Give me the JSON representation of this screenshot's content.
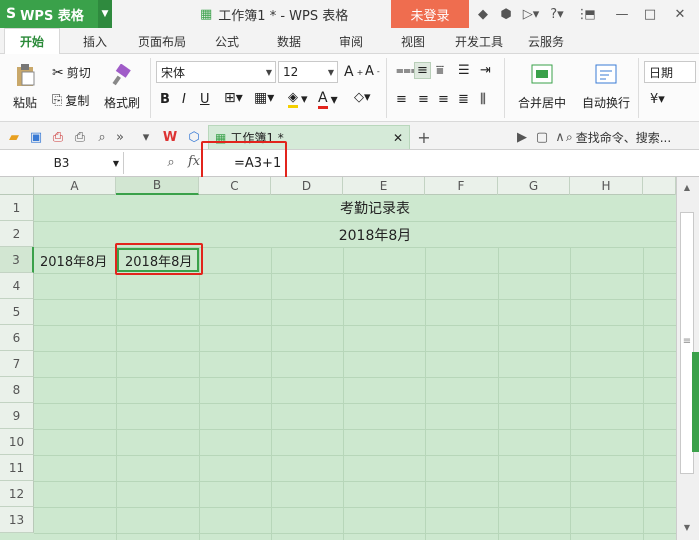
{
  "app": {
    "logo_text": "WPS 表格",
    "window_title": "工作簿1 * - WPS 表格",
    "login_label": "未登录"
  },
  "menu": {
    "tabs": [
      "开始",
      "插入",
      "页面布局",
      "公式",
      "数据",
      "审阅",
      "视图",
      "开发工具",
      "云服务"
    ]
  },
  "ribbon": {
    "paste_label": "粘贴",
    "cut_label": "剪切",
    "copy_label": "复制",
    "format_painter_label": "格式刷",
    "font_name": "宋体",
    "font_size": "12",
    "merge_label": "合并居中",
    "wrap_label": "自动换行",
    "number_format": "日期"
  },
  "qa": {
    "doc_tab": "工作簿1 *",
    "search_placeholder": "查找命令、搜索..."
  },
  "formula_bar": {
    "name_box": "B3",
    "fx": "fx",
    "formula": "=A3+1"
  },
  "sheet": {
    "columns": [
      "A",
      "B",
      "C",
      "D",
      "E",
      "F",
      "G",
      "H"
    ],
    "rows": [
      "1",
      "2",
      "3",
      "4",
      "5",
      "6",
      "7",
      "8",
      "9",
      "10",
      "11",
      "12",
      "13"
    ],
    "title": "考勤记录表",
    "subtitle": "2018年8月",
    "a3": "2018年8月",
    "b3": "2018年8月",
    "selected_cell": "B3"
  },
  "colors": {
    "brand": "#3aa14a",
    "login": "#ef6d4f",
    "highlight": "#e2241c",
    "grid": "#cde8cf"
  }
}
